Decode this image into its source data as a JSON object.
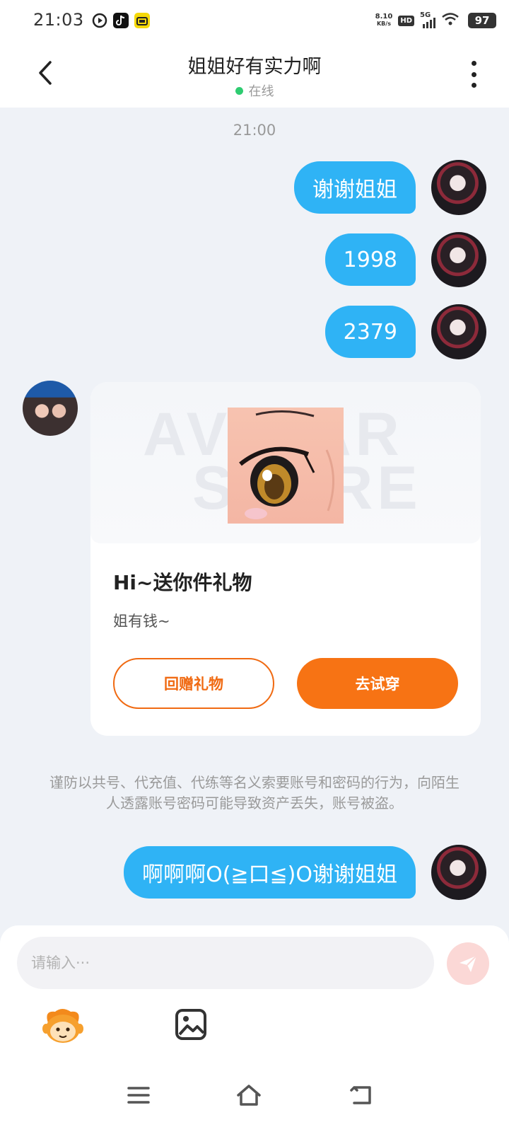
{
  "status_bar": {
    "time": "21:03",
    "net_speed_value": "8.10",
    "net_speed_unit": "KB/s",
    "hd_label": "HD",
    "signal_label": "5G",
    "battery": "97",
    "app_icons": [
      "play-icon",
      "tiktok-icon",
      "yellow-app-icon"
    ]
  },
  "header": {
    "title": "姐姐好有实力啊",
    "status": "在线"
  },
  "chat": {
    "timestamp": "21:00",
    "messages": [
      {
        "text": "谢谢姐姐"
      },
      {
        "text": "1998"
      },
      {
        "text": "2379"
      }
    ],
    "gift_card": {
      "watermark_line1": "AVATAR",
      "watermark_line2": "STORE",
      "title": "Hi~送你件礼物",
      "subtitle": "姐有钱~",
      "return_button": "回赠礼物",
      "try_button": "去试穿"
    },
    "warning": "谨防以共号、代充值、代练等名义索要账号和密码的行为，向陌生人透露账号密码可能导致资产丢失，账号被盗。",
    "last_message": "啊啊啊O(≧口≦)O谢谢姐姐"
  },
  "input": {
    "placeholder": "请输入···"
  },
  "colors": {
    "bubble": "#2fb3f5",
    "accent_orange": "#f77314",
    "online_dot": "#2ecc71",
    "background": "#eff2f7"
  }
}
